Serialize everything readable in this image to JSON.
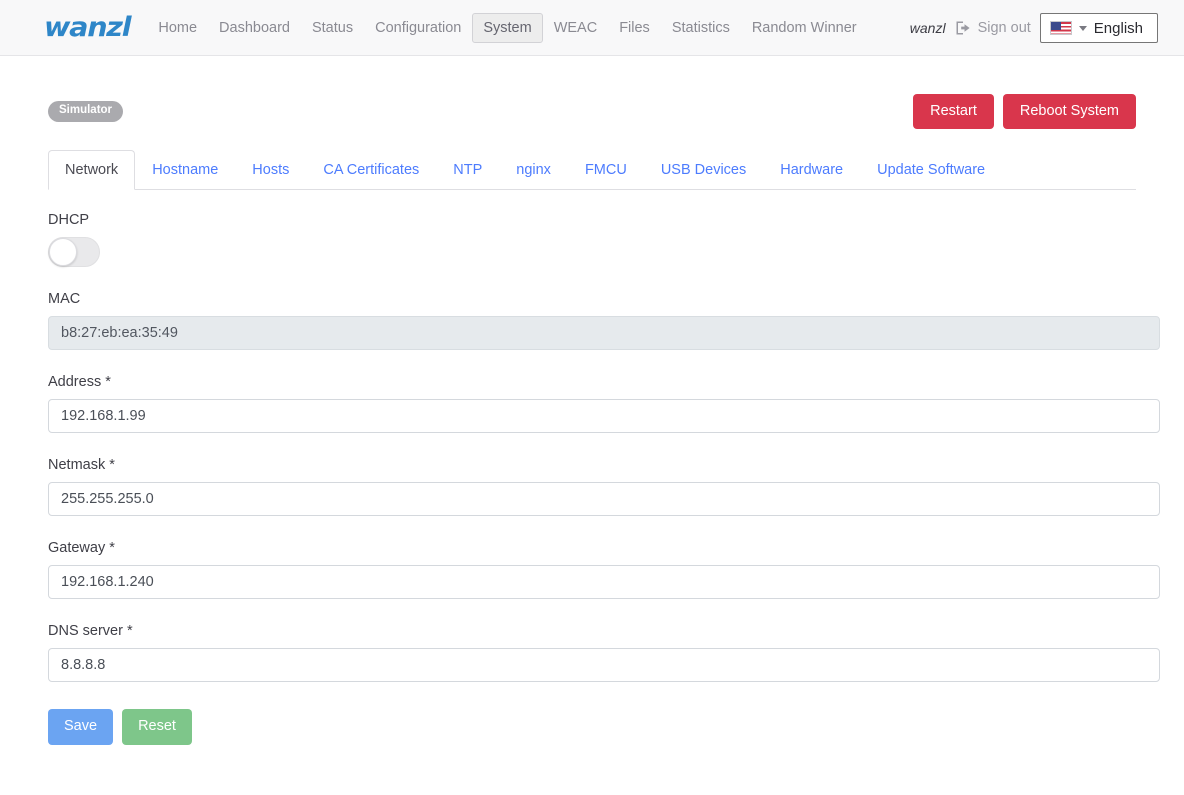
{
  "navbar": {
    "brand": "wanzl",
    "items": [
      {
        "label": "Home",
        "active": false
      },
      {
        "label": "Dashboard",
        "active": false
      },
      {
        "label": "Status",
        "active": false
      },
      {
        "label": "Configuration",
        "active": false
      },
      {
        "label": "System",
        "active": true
      },
      {
        "label": "WEAC",
        "active": false
      },
      {
        "label": "Files",
        "active": false
      },
      {
        "label": "Statistics",
        "active": false
      },
      {
        "label": "Random Winner",
        "active": false
      }
    ],
    "user_name": "wanzl",
    "signout_label": "Sign out",
    "signout_icon": "sign-out-icon",
    "language": {
      "flag_icon": "us-flag-icon",
      "selected": "English",
      "caret_icon": "chevron-down-icon"
    }
  },
  "page": {
    "badge": "Simulator",
    "restart_label": "Restart",
    "reboot_label": "Reboot System"
  },
  "tabs": [
    {
      "label": "Network",
      "active": true
    },
    {
      "label": "Hostname",
      "active": false
    },
    {
      "label": "Hosts",
      "active": false
    },
    {
      "label": "CA Certificates",
      "active": false
    },
    {
      "label": "NTP",
      "active": false
    },
    {
      "label": "nginx",
      "active": false
    },
    {
      "label": "FMCU",
      "active": false
    },
    {
      "label": "USB Devices",
      "active": false
    },
    {
      "label": "Hardware",
      "active": false
    },
    {
      "label": "Update Software",
      "active": false
    }
  ],
  "form": {
    "dhcp_label": "DHCP",
    "dhcp_enabled": false,
    "mac_label": "MAC",
    "mac_value": "b8:27:eb:ea:35:49",
    "address_label": "Address *",
    "address_value": "192.168.1.99",
    "netmask_label": "Netmask *",
    "netmask_value": "255.255.255.0",
    "gateway_label": "Gateway *",
    "gateway_value": "192.168.1.240",
    "dns_label": "DNS server *",
    "dns_value": "8.8.8.8",
    "save_label": "Save",
    "reset_label": "Reset"
  },
  "colors": {
    "brand_blue": "#2e86c8",
    "link_blue": "#4d7cfe",
    "danger_red": "#d9364c",
    "save_blue": "#6ba4f2",
    "reset_green": "#7ec68a",
    "badge_gray": "#aaaaae"
  }
}
